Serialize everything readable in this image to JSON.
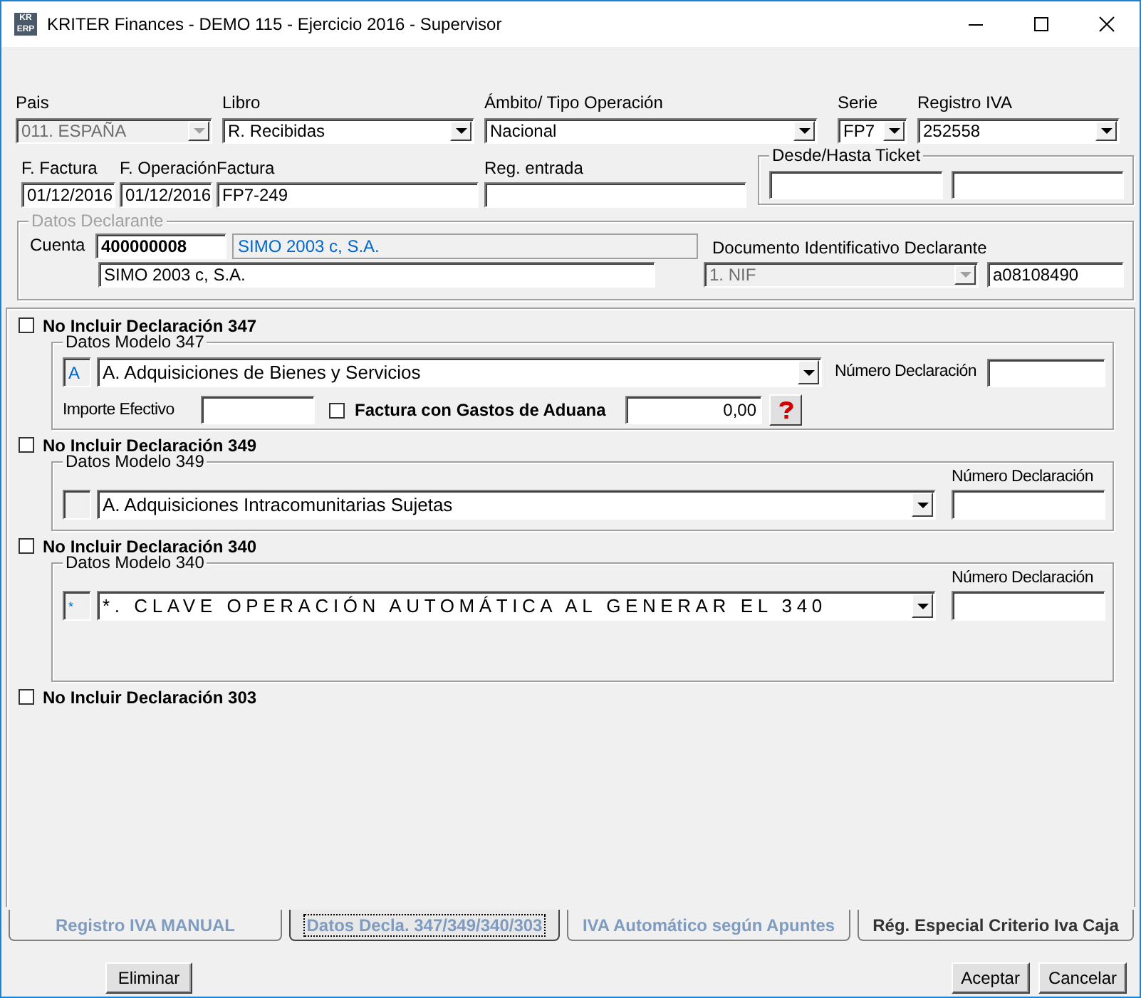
{
  "window": {
    "title": "KRITER Finances - DEMO 115 - Ejercicio 2016 - Supervisor",
    "logo_top": "KR",
    "logo_bottom": "ERP"
  },
  "row1": [
    {
      "label": "Pais",
      "value": "011. ESPAÑA",
      "disabled": true
    },
    {
      "label": "Libro",
      "value": "R. Recibidas",
      "disabled": false
    },
    {
      "label": "Ámbito/ Tipo Operación",
      "value": "Nacional",
      "disabled": false
    },
    {
      "label": "Serie",
      "value": "FP7",
      "disabled": false
    },
    {
      "label": "Registro IVA",
      "value": "252558",
      "disabled": false
    }
  ],
  "row2": [
    {
      "label": "F. Factura",
      "value": "01/12/2016"
    },
    {
      "label": "F. Operación",
      "value": "01/12/2016"
    },
    {
      "label": "Factura",
      "value": "FP7-249"
    },
    {
      "label": "Reg. entrada"
    }
  ],
  "ticket": {
    "title": "Desde/Hasta Ticket"
  },
  "declarante": {
    "title": "Datos Declarante",
    "disabled": true,
    "cuenta_label": "Cuenta",
    "cuenta": "400000008",
    "cuenta_name": "SIMO 2003 c, S.A.",
    "name": "SIMO 2003 c, S.A.",
    "doc_label": "Documento Identificativo Declarante",
    "doc_type": "1. NIF",
    "doc_type_disabled": true,
    "doc_number": "a08108490"
  },
  "declarations": [
    {
      "kind": "extended",
      "label": "No Incluir Declaración 347",
      "checked": false,
      "group_title": "Datos Modelo 347",
      "code": "A",
      "value": "A. Adquisiciones de Bienes y Servicios",
      "numero_label": "Número Declaración",
      "importe_label": "Importe Efectivo",
      "aduana_label": "Factura con Gastos de Aduana",
      "aduana_checked": false,
      "amount": "0,00"
    },
    {
      "kind": "basic",
      "label": "No Incluir Declaración 349",
      "checked": false,
      "group_title": "Datos Modelo 349",
      "value": "A. Adquisiciones Intracomunitarias Sujetas",
      "numero_label": "Número Declaración"
    },
    {
      "kind": "tall",
      "label": "No Incluir Declaración 340",
      "checked": false,
      "group_title": "Datos Modelo 340",
      "code": "*",
      "value": "*.   CLAVE OPERACIÓN AUTOMÁTICA AL GENERAR EL 340",
      "numero_label": "Número Declaración"
    },
    {
      "kind": "none",
      "label": "No Incluir Declaración 303",
      "checked": false
    }
  ],
  "tabs": [
    {
      "label": "Registro IVA MANUAL",
      "selected": false,
      "dimmed": true
    },
    {
      "label": "Datos Decla. 347/349/340/303",
      "selected": true,
      "dimmed": true
    },
    {
      "label": "IVA Automático según Apuntes",
      "selected": false,
      "dimmed": true
    },
    {
      "label": "Rég. Especial Criterio Iva Caja",
      "selected": false,
      "dimmed": false
    }
  ],
  "buttons": {
    "left": [
      "Eliminar"
    ],
    "right": [
      "Aceptar",
      "Cancelar"
    ]
  }
}
